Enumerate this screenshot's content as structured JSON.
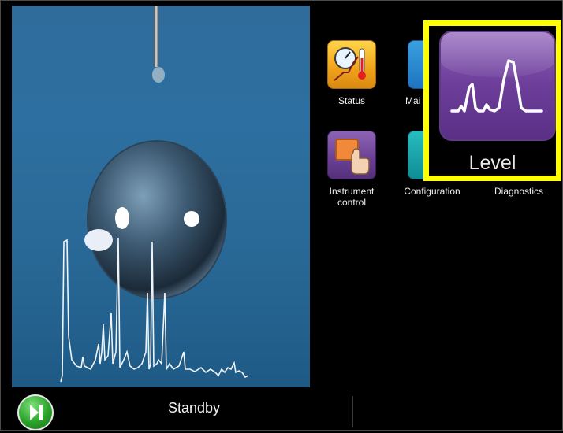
{
  "apps": [
    {
      "id": "status",
      "label": "Status"
    },
    {
      "id": "maintenance",
      "label": "Mai"
    },
    {
      "id": "instrument_control",
      "label": "Instrument\ncontrol"
    },
    {
      "id": "configuration",
      "label": "Configuration"
    },
    {
      "id": "diagnostics",
      "label": "Diagnostics"
    }
  ],
  "highlighted_app": {
    "label": "Level",
    "icon": "level-chromatogram-icon",
    "highlight_color": "#ffff00"
  },
  "status_bar": {
    "state": "Standby",
    "play_icon": "play-pause-icon"
  },
  "colors": {
    "background": "#000000",
    "highlight": "#ffff00",
    "level_tile": "#6c3e9a"
  }
}
